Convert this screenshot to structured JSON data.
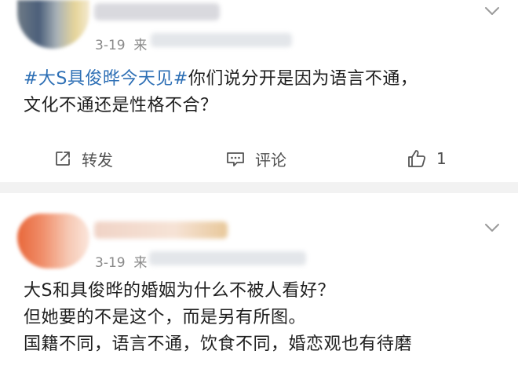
{
  "posts": [
    {
      "time": "3-19",
      "source_prefix": "来",
      "hashtag": "#大S具俊晔今天见#",
      "text_line1": "你们说分开是因为语言不通，",
      "text_line2": "文化不通还是性格不合？",
      "actions": {
        "repost": "转发",
        "comment": "评论",
        "like_count": "1"
      }
    },
    {
      "time": "3-19",
      "source_prefix": "来",
      "lines": [
        "大S和具俊晔的婚姻为什么不被人看好？",
        "但她要的不是这个，而是另有所图。",
        "国籍不同，语言不通，饮食不同，婚恋观也有待磨"
      ]
    }
  ],
  "icons": {
    "more": "chevron-down-icon",
    "repost": "repost-icon",
    "comment": "comment-icon",
    "like": "thumbs-up-icon"
  },
  "colors": {
    "hashtag": "#2d6fb5",
    "meta": "#8a8a8a",
    "separator": "#f2f2f2"
  }
}
